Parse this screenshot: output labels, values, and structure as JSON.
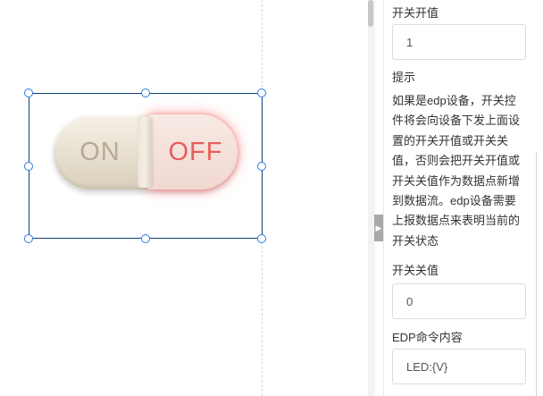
{
  "switch_widget": {
    "on_label": "ON",
    "off_label": "OFF",
    "state": "off"
  },
  "panel": {
    "switch_on_value": {
      "label": "开关开值",
      "value": "1"
    },
    "hint": {
      "label": "提示",
      "text": "如果是edp设备，开关控件将会向设备下发上面设置的开关开值或开关关值，否则会把开关开值或开关关值作为数据点新增到数据流。edp设备需要上报数据点来表明当前的开关状态"
    },
    "switch_off_value": {
      "label": "开关关值",
      "value": "0"
    },
    "edp_command": {
      "label": "EDP命令内容",
      "value": "LED:{V}"
    }
  },
  "colors": {
    "selection_border": "#0e3f7c",
    "handle": "#2c7be5",
    "off_text": "#e85c5c",
    "on_text": "#b7a996"
  }
}
